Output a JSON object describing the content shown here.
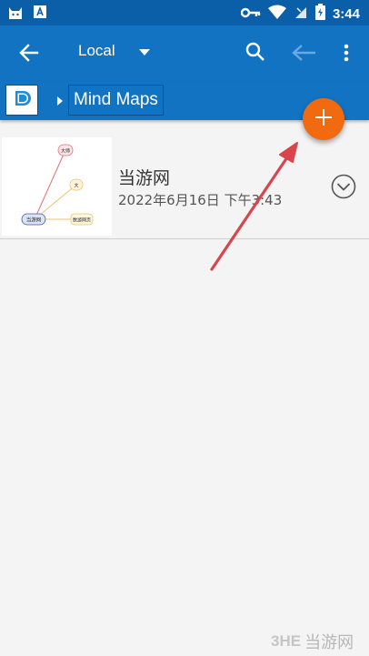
{
  "status_bar": {
    "time": "3:44",
    "icons": [
      "cat-app-icon",
      "font-app-icon",
      "key-icon",
      "wifi-icon",
      "no-sim-icon",
      "battery-icon"
    ]
  },
  "app_bar": {
    "location_label": "Local",
    "icons": [
      "back-arrow-icon",
      "dropdown-triangle-icon",
      "search-icon",
      "nav-back-icon",
      "more-vertical-icon"
    ]
  },
  "breadcrumb": {
    "items": [
      {
        "label": "Mind Maps"
      }
    ]
  },
  "fab": {
    "icon": "plus-icon",
    "color": "#f26a10"
  },
  "files": [
    {
      "name": "当游网",
      "date": "2022年6月16日 下午3:43",
      "thumbnail": {
        "central_node": "当游网",
        "child_nodes": [
          "大师",
          "大",
          "数游网页"
        ]
      }
    }
  ],
  "watermark": {
    "logo": "3HE",
    "text": "当游网"
  },
  "colors": {
    "status_bar": "#0b5fa8",
    "app_bar": "#1273c3",
    "fab": "#f26a10",
    "annotation_arrow": "#d8464b",
    "background": "#f4f4f4"
  }
}
